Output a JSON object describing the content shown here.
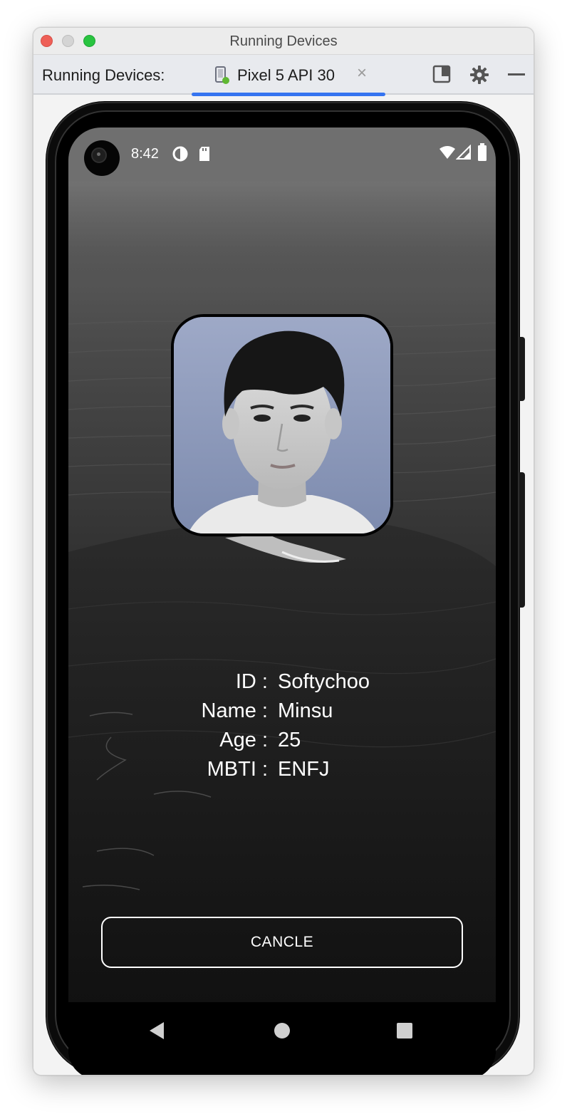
{
  "window": {
    "title": "Running Devices"
  },
  "toolbar": {
    "label": "Running Devices:",
    "tab_label": "Pixel 5 API 30",
    "tab_close": "×"
  },
  "statusbar": {
    "time": "8:42"
  },
  "profile": {
    "rows": [
      {
        "key": "ID :",
        "value": "Softychoo"
      },
      {
        "key": "Name :",
        "value": "Minsu"
      },
      {
        "key": "Age :",
        "value": "25"
      },
      {
        "key": "MBTI :",
        "value": "ENFJ"
      }
    ]
  },
  "actions": {
    "cancel_label": "CANCLE"
  },
  "icons": {
    "device_tab": "phone-device-icon",
    "layout": "layout-icon",
    "settings": "gear-icon",
    "minimize": "minimize-icon",
    "wifi": "wifi-icon",
    "signal": "signal-icon",
    "battery": "battery-icon",
    "back": "back-triangle-icon",
    "home": "home-circle-icon",
    "recents": "recents-square-icon"
  },
  "colors": {
    "tab_accent": "#3574f0",
    "status_bar": "#6f6f6f",
    "avatar_bg": "#9aa6c4"
  }
}
